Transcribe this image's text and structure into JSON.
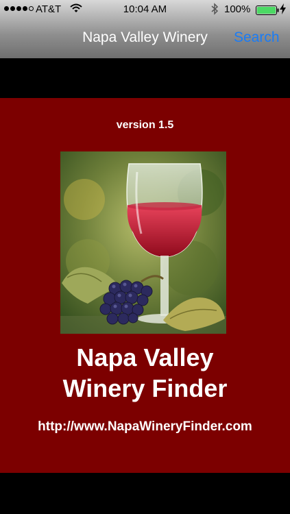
{
  "status_bar": {
    "carrier": "AT&T",
    "time": "10:04 AM",
    "battery_percent": "100%",
    "battery_color": "#4cd964",
    "icons": [
      "signal-dots-icon",
      "wifi-icon",
      "bluetooth-icon",
      "battery-icon",
      "charging-bolt-icon"
    ]
  },
  "nav_bar": {
    "title": "Napa Valley Winery",
    "search_label": "Search",
    "search_color": "#1a7cf5"
  },
  "content": {
    "background_color": "#7c0000",
    "version": "version 1.5",
    "app_title_line1": "Napa Valley",
    "app_title_line2": "Winery Finder",
    "url": "http://www.NapaWineryFinder.com",
    "image_subject": "wine-glass-with-grapes"
  }
}
